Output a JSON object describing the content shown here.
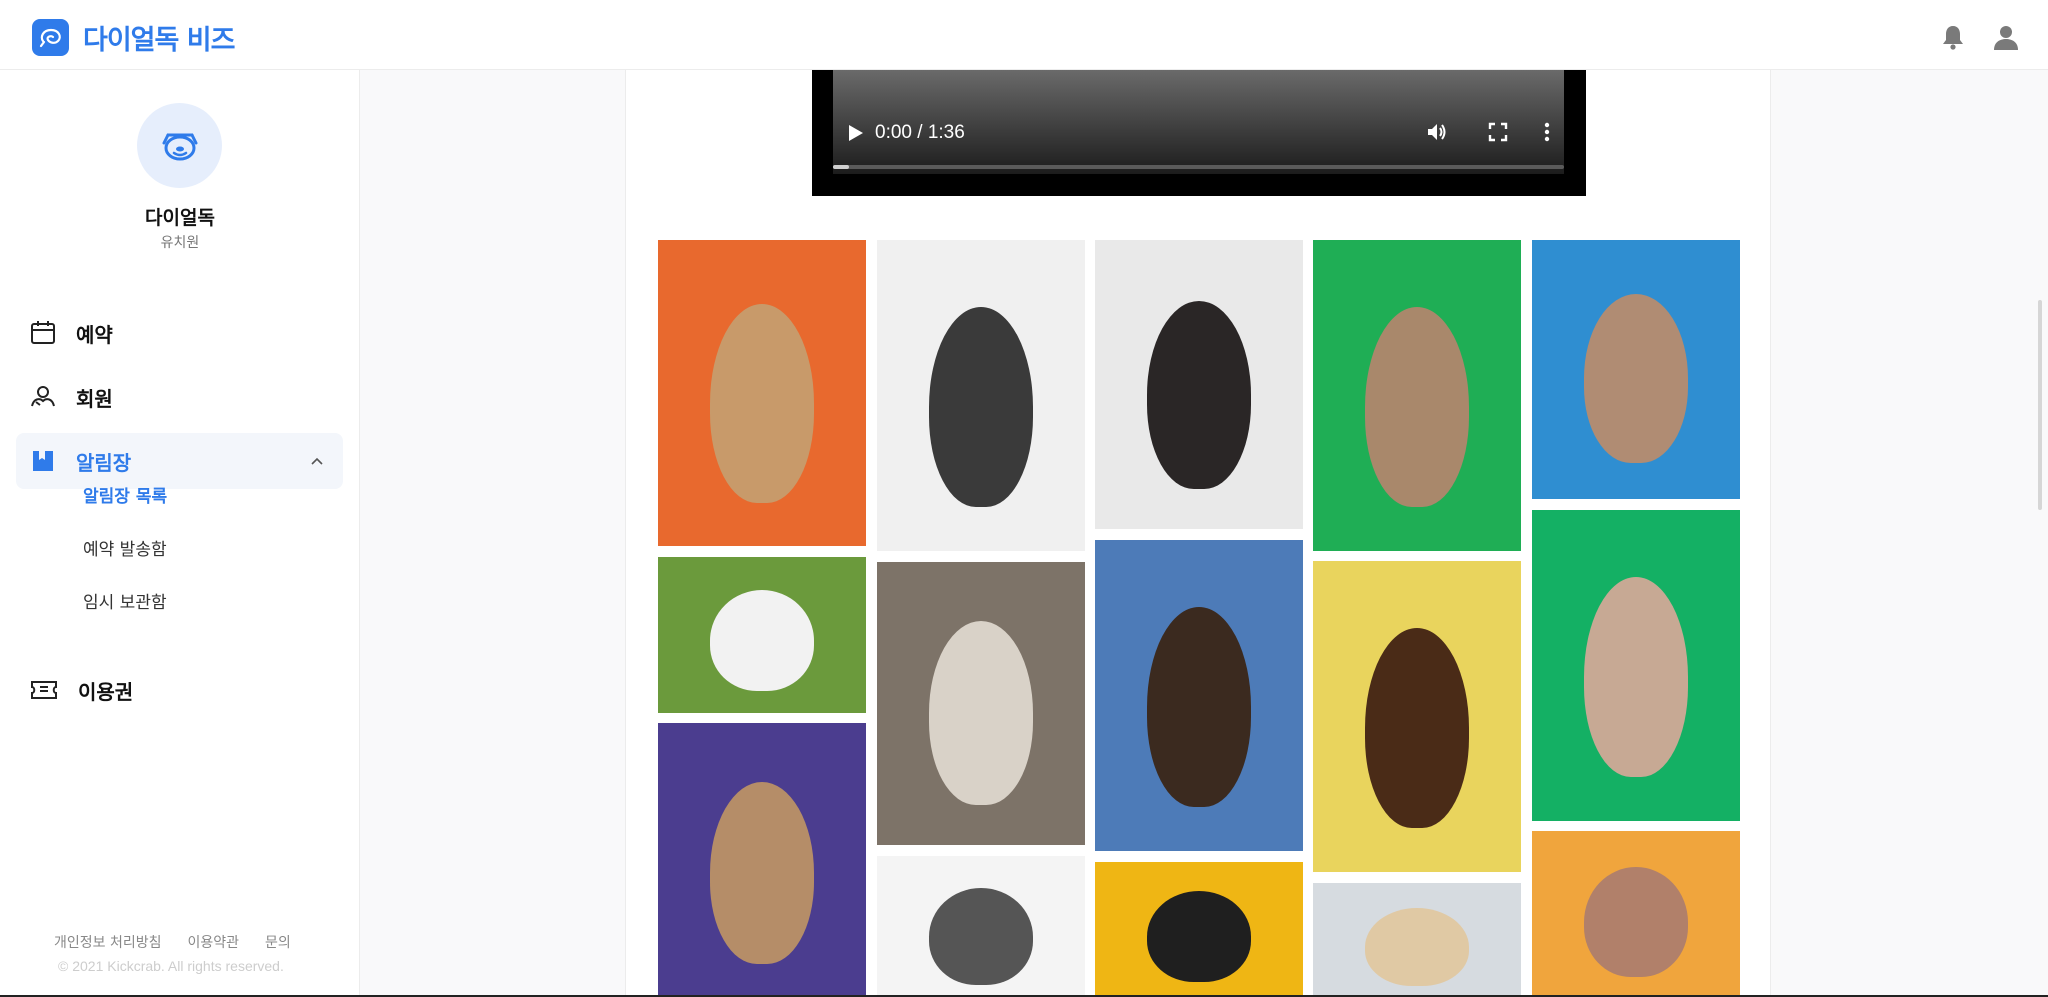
{
  "app": {
    "logo_text": "다이얼독 비즈"
  },
  "profile": {
    "name": "다이얼독",
    "type": "유치원"
  },
  "nav": {
    "reservation": "예약",
    "members": "회원",
    "notice": "알림장",
    "notice_sub": [
      "알림장 목록",
      "예약 발송함",
      "임시 보관함"
    ],
    "passes": "이용권"
  },
  "footer": {
    "links": [
      "개인정보 처리방침",
      "이용약관",
      "문의"
    ],
    "copyright": "© 2021 Kickcrab. All rights reserved."
  },
  "video": {
    "time": "0:00 / 1:36",
    "progress": 0.0
  },
  "gallery": {
    "photos": [
      {
        "desc": "corgi puppy",
        "bg": "#e8692e",
        "dog": "#c89a6a"
      },
      {
        "desc": "maltese on grass",
        "bg": "#6b9a3c",
        "dog": "#f2f2f2"
      },
      {
        "desc": "french bulldog looking up",
        "bg": "#4b3d8f",
        "dog": "#b58d68"
      },
      {
        "desc": "black and white dog",
        "bg": "#f0f0f0",
        "dog": "#3a3a3a"
      },
      {
        "desc": "dogs on street",
        "bg": "#7d7368",
        "dog": "#d9d2c8"
      },
      {
        "desc": "dog with goggles",
        "bg": "#f4f4f4",
        "dog": "#555555"
      },
      {
        "desc": "pug in denim jacket",
        "bg": "#e9e9e9",
        "dog": "#2a2626"
      },
      {
        "desc": "dog by pool",
        "bg": "#4d7bb8",
        "dog": "#3b2a1f"
      },
      {
        "desc": "black dog on yellow",
        "bg": "#efb614",
        "dog": "#1f1f1f"
      },
      {
        "desc": "dog in party hat",
        "bg": "#1fae55",
        "dog": "#a9886b"
      },
      {
        "desc": "dachshund with sunglasses",
        "bg": "#e9d45d",
        "dog": "#4a2b17"
      },
      {
        "desc": "dog on bed",
        "bg": "#d6dbe0",
        "dog": "#e0c9a4"
      },
      {
        "desc": "bulldog in yellow sweater",
        "bg": "#2f8ed1",
        "dog": "#b08c73"
      },
      {
        "desc": "bulldog with chain",
        "bg": "#14b064",
        "dog": "#c7a994"
      },
      {
        "desc": "bulldog on orange",
        "bg": "#f0a53d",
        "dog": "#b1806a"
      }
    ]
  },
  "colors": {
    "accent": "#2f7bea",
    "active_bg": "#f3f6fb"
  }
}
